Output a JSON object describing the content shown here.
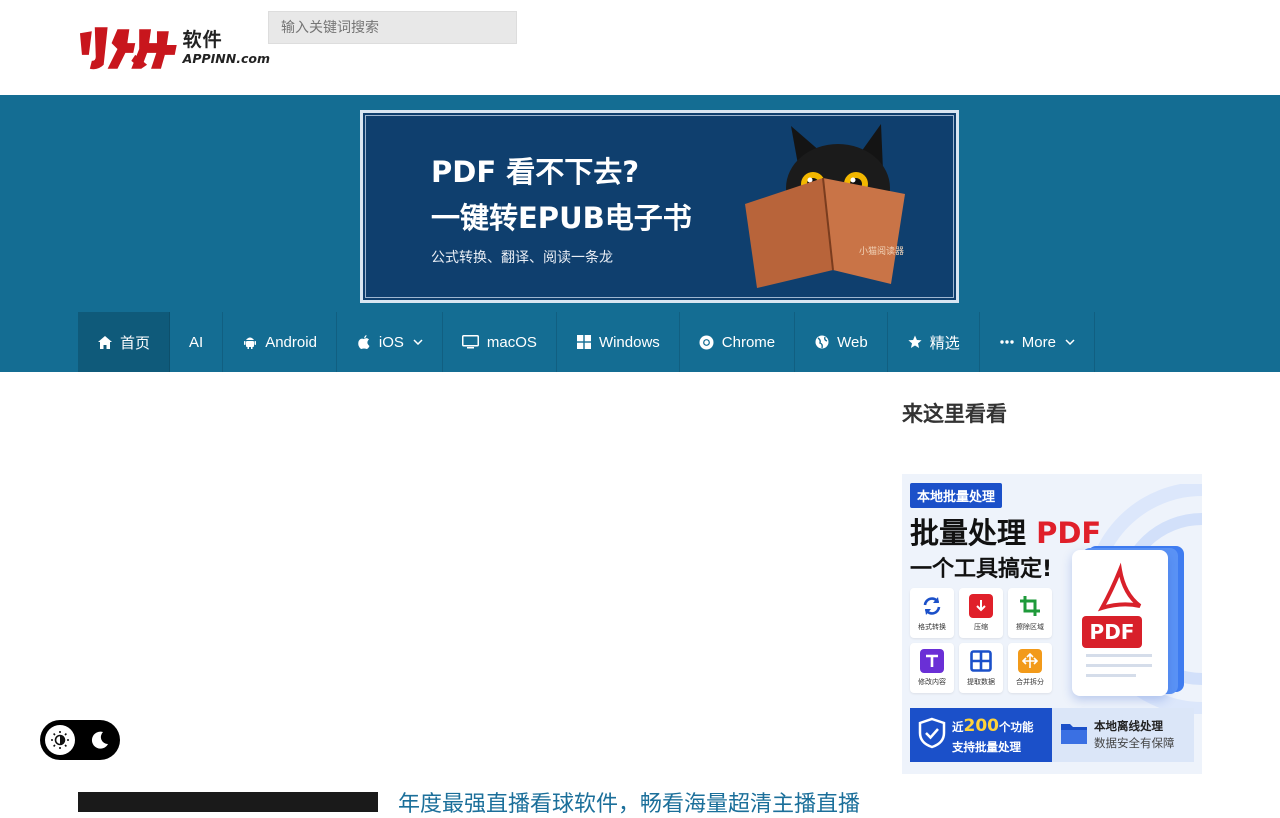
{
  "header": {
    "logo": {
      "cn": "软件",
      "en": "APPINN.com"
    },
    "search": {
      "placeholder": "输入关键词搜索"
    }
  },
  "banner": {
    "line1": "PDF 看不下去?",
    "line2": "一键转EPUB电子书",
    "sub": "公式转换、翻译、阅读一条龙",
    "book_text": "小猫阅读器"
  },
  "nav": {
    "items": [
      {
        "label": "首页",
        "icon": "home-icon"
      },
      {
        "label": "AI",
        "icon": ""
      },
      {
        "label": "Android",
        "icon": "android-icon"
      },
      {
        "label": "iOS",
        "icon": "apple-icon",
        "dropdown": true
      },
      {
        "label": "macOS",
        "icon": "monitor-icon"
      },
      {
        "label": "Windows",
        "icon": "windows-icon"
      },
      {
        "label": "Chrome",
        "icon": "chrome-icon"
      },
      {
        "label": "Web",
        "icon": "globe-icon"
      },
      {
        "label": "精选",
        "icon": "star-icon"
      },
      {
        "label": "More",
        "icon": "ellipsis-icon",
        "dropdown": true
      }
    ]
  },
  "sidebar": {
    "title": "来这里看看",
    "ad": {
      "tag": "本地批量处理",
      "headline_a": "批量处理 ",
      "headline_b": "PDF",
      "headline2": "一个工具搞定!",
      "features": [
        "格式转换",
        "压缩",
        "擦除区域",
        "修改内容",
        "提取数据",
        "合并拆分"
      ],
      "pdf_badge": "PDF",
      "bottom_left_a": "近",
      "bottom_left_num": "200",
      "bottom_left_b": "个功能",
      "bottom_left_2": "支持批量处理",
      "bottom_right_1": "本地离线处理",
      "bottom_right_2": "数据安全有保障"
    }
  },
  "post": {
    "title": "年度最强直播看球软件，畅看海量超清主播直播"
  },
  "colors": {
    "brand_band": "#146d93",
    "nav_active": "#0f5a7a",
    "link": "#1b6f9a",
    "logo_red": "#c8161d"
  }
}
